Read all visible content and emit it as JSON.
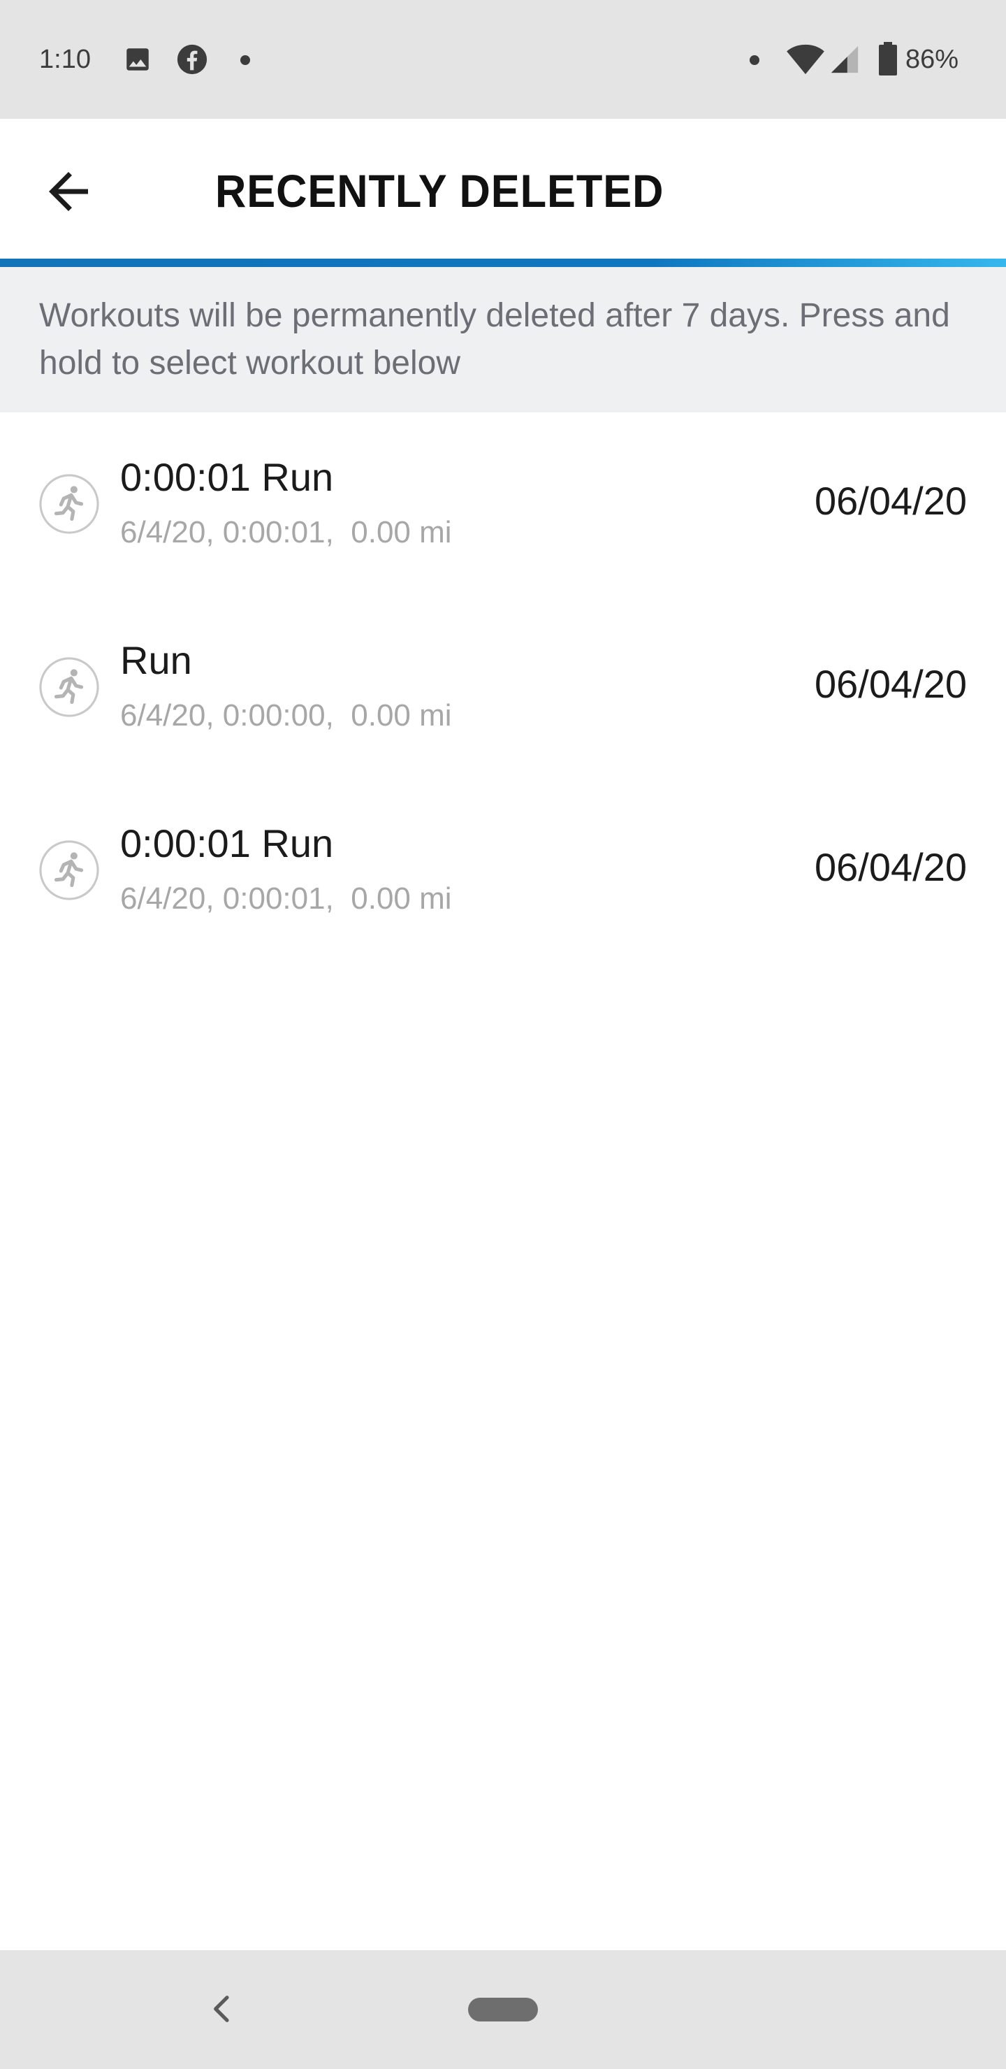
{
  "status_bar": {
    "time": "1:10",
    "battery": "86%",
    "icons": [
      "image-icon",
      "facebook-icon",
      "notification-dot",
      "wifi-icon",
      "cell-signal-icon",
      "battery-icon"
    ]
  },
  "header": {
    "title": "RECENTLY DELETED",
    "back_icon": "arrow-left-icon",
    "accent_color": "#1173b8"
  },
  "info_banner": {
    "text": "Workouts will be permanently deleted after 7 days. Press and hold to select workout below"
  },
  "workouts": [
    {
      "title": "0:00:01 Run",
      "subtitle": "6/4/20, 0:00:01,  0.00 mi",
      "date": "06/04/20",
      "icon": "running-person-icon"
    },
    {
      "title": "Run",
      "subtitle": "6/4/20, 0:00:00,  0.00 mi",
      "date": "06/04/20",
      "icon": "running-person-icon"
    },
    {
      "title": "0:00:01 Run",
      "subtitle": "6/4/20, 0:00:01,  0.00 mi",
      "date": "06/04/20",
      "icon": "running-person-icon"
    }
  ],
  "nav_bar": {
    "icons": [
      "chevron-left-icon",
      "home-pill-icon"
    ]
  }
}
